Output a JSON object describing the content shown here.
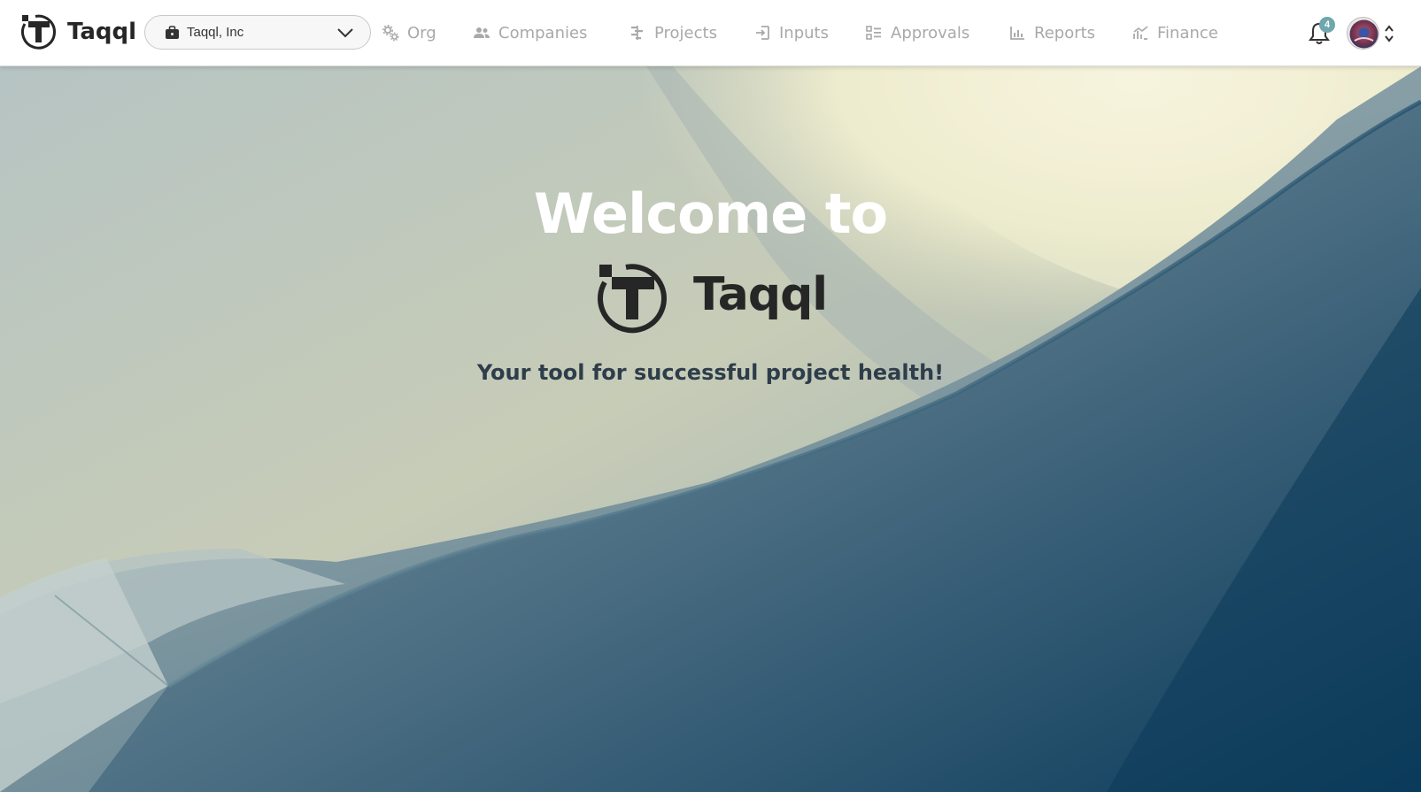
{
  "app": {
    "name": "Taqql"
  },
  "org_selector": {
    "value": "Taqql, Inc",
    "icon": "briefcase-icon"
  },
  "nav": [
    {
      "label": "Org",
      "icon": "settings-cog-icon"
    },
    {
      "label": "Companies",
      "icon": "people-icon"
    },
    {
      "label": "Projects",
      "icon": "projects-icon"
    },
    {
      "label": "Inputs",
      "icon": "input-icon"
    },
    {
      "label": "Approvals",
      "icon": "checklist-icon"
    },
    {
      "label": "Reports",
      "icon": "bar-chart-icon"
    },
    {
      "label": "Finance",
      "icon": "finance-icon"
    }
  ],
  "notifications": {
    "count": "4",
    "badge_color": "#6ea7ad"
  },
  "hero": {
    "welcome": "Welcome to",
    "brand": "Taqql",
    "tagline": "Your tool for successful project health!"
  },
  "colors": {
    "nav_text": "#a9a9a9",
    "brand_dark": "#262626",
    "tagline": "#2e3d4a"
  }
}
